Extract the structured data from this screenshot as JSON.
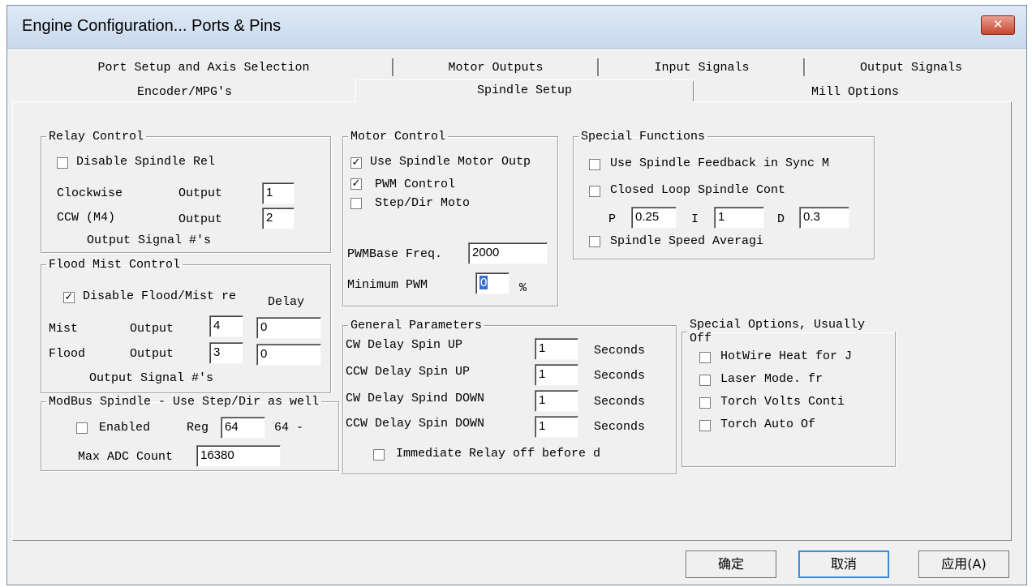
{
  "window": {
    "title": "Engine Configuration... Ports & Pins",
    "close_label": "✕"
  },
  "tabs": {
    "row1": [
      "Port Setup and Axis Selection",
      "Motor Outputs",
      "Input Signals",
      "Output Signals"
    ],
    "row2": [
      "Encoder/MPG's",
      "Spindle Setup",
      "Mill Options"
    ],
    "active": "Spindle Setup"
  },
  "relay_control": {
    "legend": "Relay Control",
    "disable_label": "Disable Spindle Rel",
    "disable_checked": false,
    "cw_label": "Clockwise",
    "cw_output_label": "Output",
    "cw_output_value": "1",
    "ccw_label": "CCW (M4)",
    "ccw_output_label": "Output",
    "ccw_output_value": "2",
    "footer": "Output Signal #'s"
  },
  "flood_mist": {
    "legend": "Flood Mist Control",
    "disable_label": "Disable Flood/Mist re",
    "disable_checked": true,
    "delay_header": "Delay",
    "mist_label": "Mist",
    "mist_output_label": "Output",
    "mist_output_value": "4",
    "mist_delay_value": "0",
    "flood_label": "Flood",
    "flood_output_label": "Output",
    "flood_output_value": "3",
    "flood_delay_value": "0",
    "footer": "Output Signal #'s"
  },
  "modbus": {
    "legend": "ModBus Spindle - Use Step/Dir as well",
    "enabled_label": "Enabled",
    "enabled_checked": false,
    "reg_label": "Reg",
    "reg_value": "64",
    "reg_suffix": "64 -",
    "max_adc_label": "Max ADC Count",
    "max_adc_value": "16380"
  },
  "motor_control": {
    "legend": "Motor Control",
    "use_spindle_label": "Use Spindle Motor Outp",
    "use_spindle_checked": true,
    "pwm_label": "PWM Control",
    "pwm_checked": true,
    "stepdir_label": "Step/Dir Moto",
    "stepdir_checked": false,
    "pwm_base_label": "PWMBase Freq.",
    "pwm_base_value": "2000",
    "min_pwm_label": "Minimum PWM",
    "min_pwm_value": "0",
    "min_pwm_unit": "%"
  },
  "general": {
    "legend": "General Parameters",
    "rows": [
      {
        "label": "CW Delay Spin UP",
        "value": "1",
        "unit": "Seconds"
      },
      {
        "label": "CCW Delay Spin UP",
        "value": "1",
        "unit": "Seconds"
      },
      {
        "label": "CW Delay Spind DOWN",
        "value": "1",
        "unit": "Seconds"
      },
      {
        "label": "CCW Delay Spin DOWN",
        "value": "1",
        "unit": "Seconds"
      }
    ],
    "immediate_label": "Immediate Relay off before d",
    "immediate_checked": false
  },
  "special_functions": {
    "legend": "Special Functions",
    "feedback_label": "Use Spindle Feedback in Sync M",
    "feedback_checked": false,
    "closed_loop_label": "Closed Loop Spindle Cont",
    "closed_loop_checked": false,
    "p_label": "P",
    "p_value": "0.25",
    "i_label": "I",
    "i_value": "1",
    "d_label": "D",
    "d_value": "0.3",
    "averaging_label": "Spindle Speed Averagi",
    "averaging_checked": false
  },
  "special_options": {
    "legend": "Special Options, Usually Off",
    "items": [
      {
        "label": "HotWire Heat for J",
        "checked": false
      },
      {
        "label": "Laser Mode. fr",
        "checked": false
      },
      {
        "label": "Torch Volts Conti",
        "checked": false
      },
      {
        "label": "Torch Auto Of",
        "checked": false
      }
    ]
  },
  "buttons": {
    "ok": "确定",
    "cancel": "取消",
    "apply": "应用(A)"
  }
}
